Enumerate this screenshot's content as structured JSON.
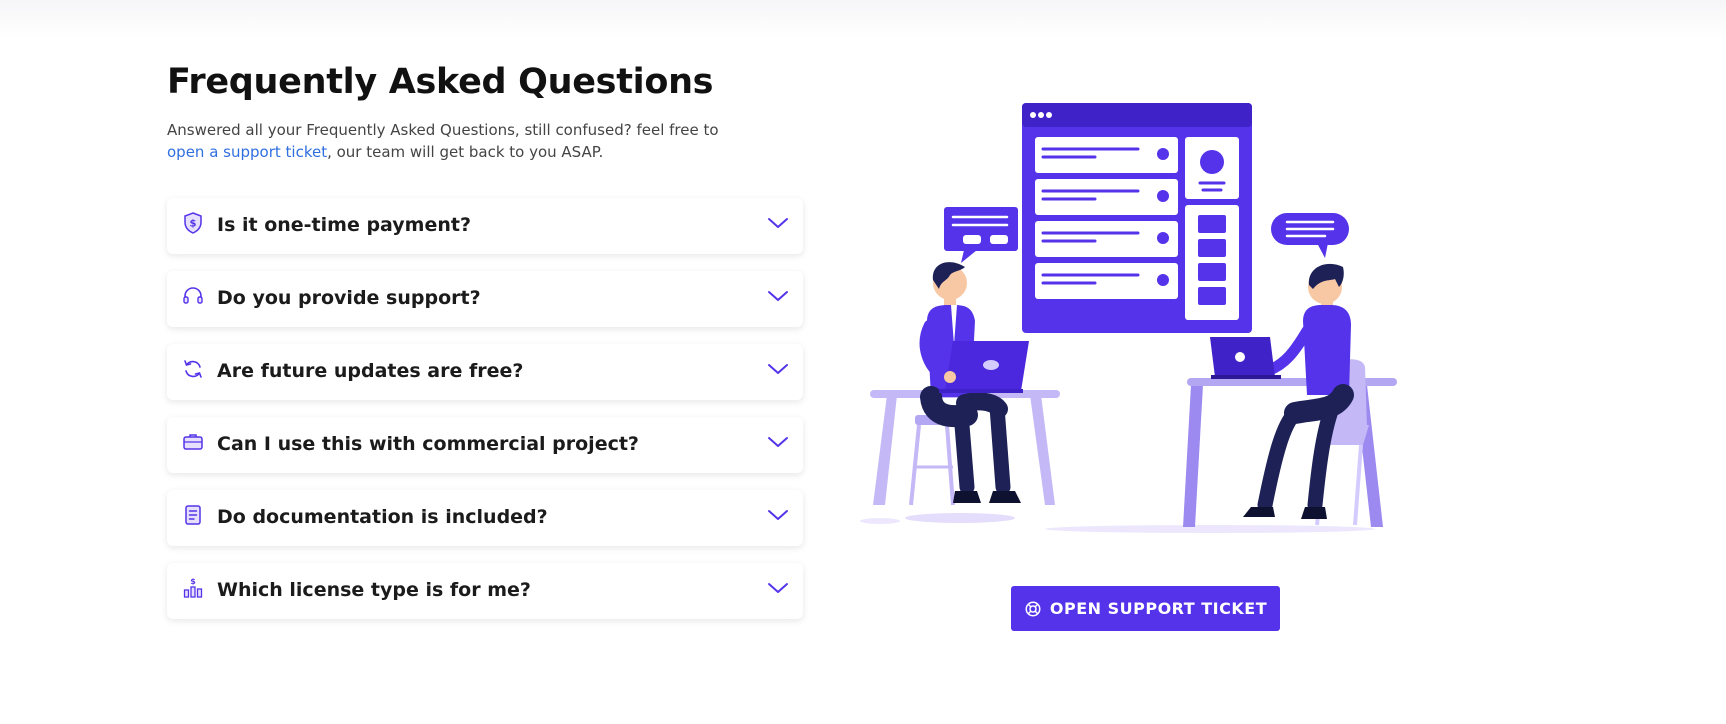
{
  "header": {
    "title": "Frequently Asked Questions",
    "subtitle_before": "Answered all your Frequently Asked Questions, still confused? feel free to ",
    "subtitle_link": "open a support ticket",
    "subtitle_after": ", our team will get back to you ASAP."
  },
  "faq": [
    {
      "question": "Is it one-time payment?",
      "icon": "shield-dollar-icon"
    },
    {
      "question": "Do you provide support?",
      "icon": "headset-icon"
    },
    {
      "question": "Are future updates are free?",
      "icon": "refresh-icon"
    },
    {
      "question": "Can I use this with commercial project?",
      "icon": "briefcase-icon"
    },
    {
      "question": "Do documentation is included?",
      "icon": "document-icon"
    },
    {
      "question": "Which license type is for me?",
      "icon": "pricing-chart-icon"
    }
  ],
  "cta": {
    "label": "OPEN SUPPORT TICKET",
    "icon": "lifebuoy-icon"
  },
  "colors": {
    "accent": "#5533ea",
    "link": "#2f6fe0",
    "heading": "#111111"
  }
}
